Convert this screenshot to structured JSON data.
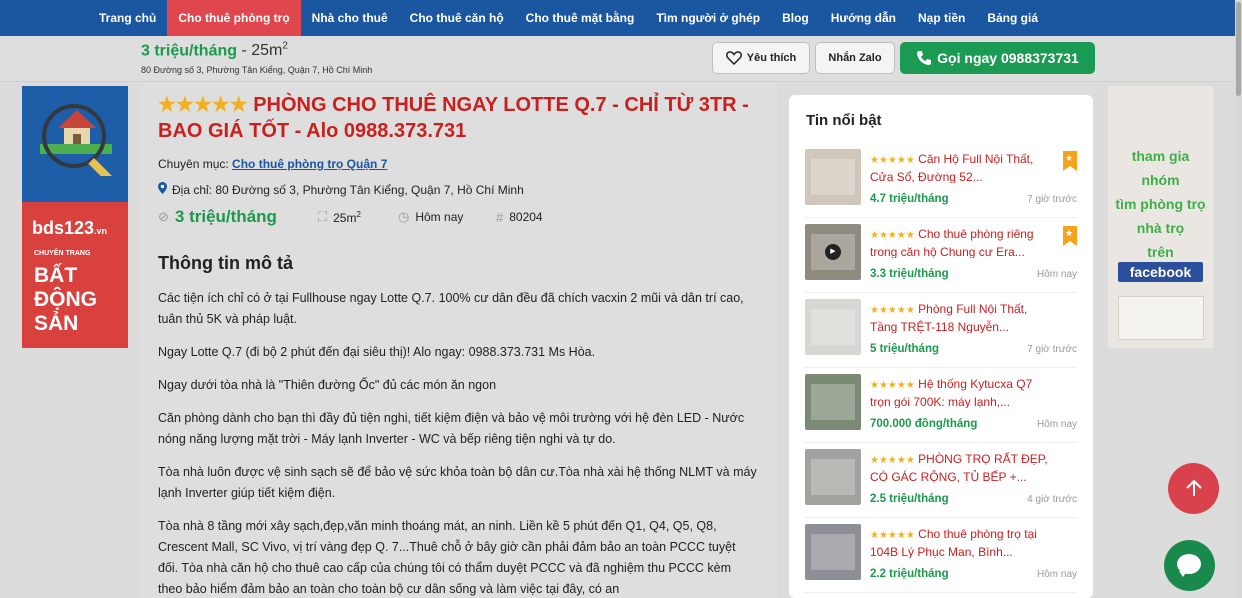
{
  "nav": {
    "items": [
      {
        "label": "Trang chủ",
        "active": false
      },
      {
        "label": "Cho thuê phòng trọ",
        "active": true
      },
      {
        "label": "Nhà cho thuê",
        "active": false
      },
      {
        "label": "Cho thuê căn hộ",
        "active": false
      },
      {
        "label": "Cho thuê mặt bằng",
        "active": false
      },
      {
        "label": "Tìm người ở ghép",
        "active": false
      },
      {
        "label": "Blog",
        "active": false
      },
      {
        "label": "Hướng dẫn",
        "active": false
      },
      {
        "label": "Nạp tiền",
        "active": false
      },
      {
        "label": "Bảng giá",
        "active": false
      }
    ],
    "colors": {
      "bg": "#1b56a1",
      "active": "#e0464e"
    }
  },
  "subheader": {
    "price": "3 triệu/tháng",
    "area_prefix": " - 25m",
    "area_sup": "2",
    "address": "80 Đường số 3, Phường Tân Kiểng, Quận 7, Hồ Chí Minh",
    "like_label": "Yêu thích",
    "zalo_label": "Nhắn Zalo",
    "call_label": "Gọi ngay 0988373731"
  },
  "banner_left": {
    "brand": "bds123",
    "brand_suffix": ".vn",
    "subtitle": "CHUYÊN TRANG",
    "headline": "BẤT ĐỘNG SẢN"
  },
  "banner_right": {
    "lines": [
      "tham gia",
      "nhóm",
      "tìm phòng trọ",
      "nhà trọ",
      "trên"
    ],
    "facebook": "facebook"
  },
  "post": {
    "stars": "★★★★★",
    "title": "PHÒNG CHO THUÊ NGAY LOTTE Q.7 - CHỈ TỪ 3TR - BAO GIÁ TỐT - Alo 0988.373.731",
    "category_label": "Chuyên mục: ",
    "category_link": "Cho thuê phòng trọ Quận 7",
    "address_label": "Địa chỉ: 80 Đường số 3, Phường Tân Kiểng, Quận 7, Hồ Chí Minh",
    "price": "3 triệu/tháng",
    "area": "25m",
    "area_sup": "2",
    "posted": "Hôm nay",
    "id": "80204",
    "desc_heading": "Thông tin mô tả",
    "paragraphs": [
      "Các tiện ích chỉ có ở tại Fullhouse ngay Lotte Q.7. 100% cư dân đều đã chích vacxin 2 mũi và dân trí cao, tuân thủ 5K và pháp luật.",
      "Ngay Lotte Q.7 (đi bộ 2 phút đến đại siêu thị)! Alo ngay: 0988.373.731 Ms Hòa.",
      "Ngay dưới tòa nhà là \"Thiên đường Ốc\" đủ các món ăn ngon",
      "Căn phòng dành cho bạn thì đầy đủ tiện nghi, tiết kiệm điện và bảo vệ môi trường với hệ đèn LED - Nước nóng năng lượng mặt trời - Máy lạnh Inverter - WC và bếp riêng tiện nghi và tự do.",
      "Tòa nhà luôn được vệ sinh sạch sẽ để bảo vệ sức khỏa toàn bộ dân cư.Tòa nhà xài hệ thống NLMT và máy lạnh Inverter giúp tiết kiệm điện.",
      "Tòa nhà 8 tầng mới xây sạch,đẹp,văn minh thoáng mát, an ninh. Liền kề 5 phút đến Q1, Q4, Q5, Q8, Crescent Mall, SC Vivo, vị trí vàng đẹp Q. 7...Thuê chỗ ở bây giờ cần phải đảm bảo an toàn PCCC tuyệt đối. Tòa nhà căn hộ cho thuê cao cấp của chúng tôi có thẩm duyệt PCCC và đã nghiệm thu PCCC kèm theo bảo hiểm đảm bảo an toàn cho toàn bộ cư dân sống và làm việc tại đây, có an"
    ]
  },
  "featured": {
    "title": "Tin nổi bật",
    "items": [
      {
        "stars": "★★★★★",
        "title": "Căn Hộ Full Nội Thất, Cửa Sổ, Đường 52...",
        "price": "4.7 triệu/tháng",
        "time": "7 giờ trước",
        "bookmark": true,
        "video": false,
        "thumb": "#cfc7bb"
      },
      {
        "stars": "★★★★★",
        "title": "Cho thuê phòng riêng trong căn hộ Chung cư Era...",
        "price": "3.3 triệu/tháng",
        "time": "Hôm nay",
        "bookmark": true,
        "video": true,
        "thumb": "#8f8a7e"
      },
      {
        "stars": "★★★★★",
        "title": "Phòng Full Nội Thất, Tầng TRỆT-118 Nguyễn...",
        "price": "5 triệu/tháng",
        "time": "7 giờ trước",
        "bookmark": false,
        "video": false,
        "thumb": "#d8d6d2"
      },
      {
        "stars": "★★★★★",
        "title": "Hệ thống Kytucxa Q7 trọn gói 700K: máy lạnh,...",
        "price": "700.000 đồng/tháng",
        "time": "Hôm nay",
        "bookmark": false,
        "video": false,
        "thumb": "#7b8a74"
      },
      {
        "stars": "★★★★★",
        "title": "PHÒNG TRỌ RẤT ĐẸP, CÓ GÁC RỘNG, TỦ BẾP +...",
        "price": "2.5 triệu/tháng",
        "time": "4 giờ trước",
        "bookmark": false,
        "video": false,
        "thumb": "#a3a29e"
      },
      {
        "stars": "★★★★★",
        "title": "Cho thuê phòng trọ tại 104B Lý Phục Man, Bình...",
        "price": "2.2 triệu/tháng",
        "time": "Hôm nay",
        "bookmark": false,
        "video": false,
        "thumb": "#8c8f95"
      }
    ]
  },
  "icons": {
    "heart": "heart-icon",
    "phone": "phone-icon",
    "pin": "map-pin-icon",
    "tag": "price-tag-icon",
    "area": "area-icon",
    "clock": "clock-icon",
    "hash": "hash-icon",
    "arrow_up": "arrow-up-icon",
    "chat": "chat-icon"
  }
}
